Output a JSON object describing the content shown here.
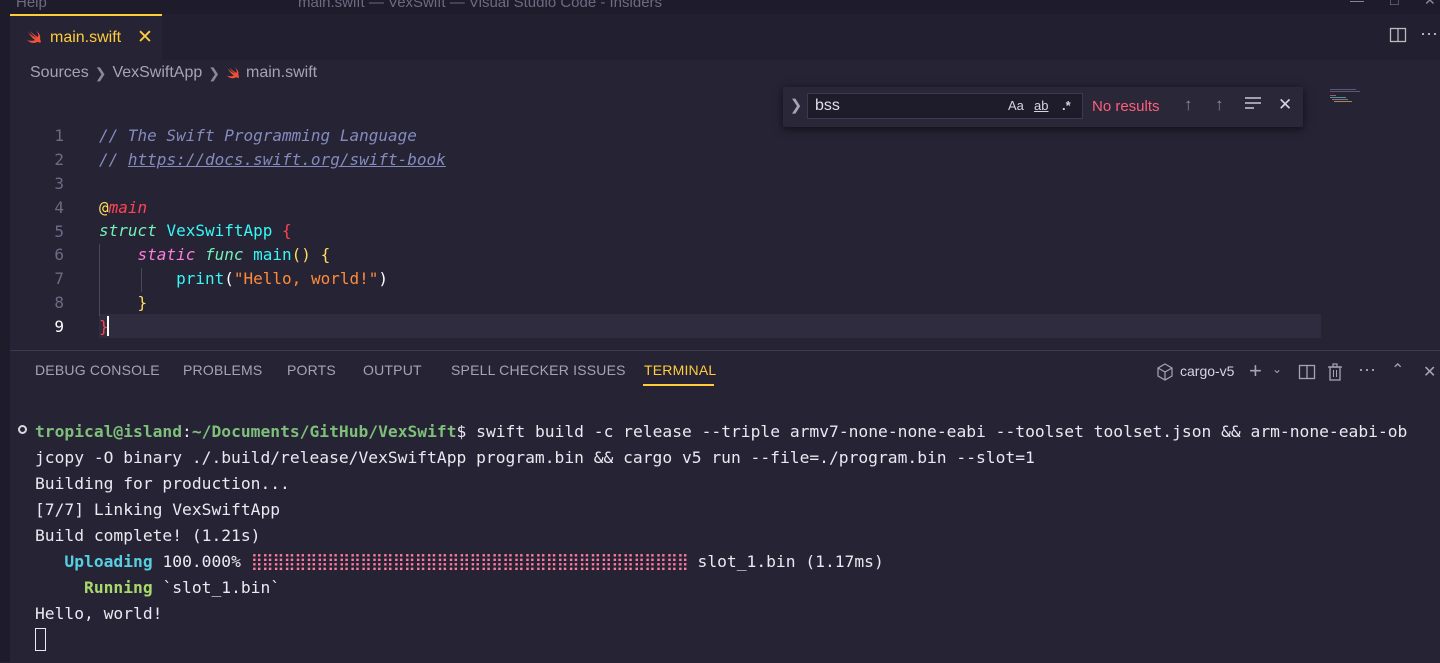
{
  "window": {
    "menu_help": "Help",
    "title": "main.swift — VexSwift — Visual Studio Code - Insiders"
  },
  "editor": {
    "tab": {
      "label": "main.swift",
      "close_icon": "close-icon"
    },
    "breadcrumb": [
      "Sources",
      "VexSwiftApp",
      "main.swift"
    ],
    "line_numbers": [
      "1",
      "2",
      "3",
      "4",
      "5",
      "6",
      "7",
      "8",
      "9"
    ],
    "current_line": "9",
    "code": {
      "l1": "// The Swift Programming Language",
      "l2_prefix": "// ",
      "l2_url": "https://docs.swift.org/swift-book",
      "l4_at": "@",
      "l4_attr": "main",
      "l5_kw": "struct",
      "l5_name": "VexSwiftApp",
      "l5_brace": "{",
      "l6_static": "static",
      "l6_func": "func",
      "l6_name": "main",
      "l6_parens": "()",
      "l6_brace": "{",
      "l7_print": "print",
      "l7_open": "(",
      "l7_str": "\"Hello, world!\"",
      "l7_close": ")",
      "l8_brace": "}",
      "l9_brace": "}"
    }
  },
  "find": {
    "query": "bss",
    "match_case": "Aa",
    "whole_word": "ab",
    "regex": ".*",
    "status": "No results"
  },
  "panel": {
    "tabs": [
      "DEBUG CONSOLE",
      "PROBLEMS",
      "PORTS",
      "OUTPUT",
      "SPELL CHECKER ISSUES",
      "TERMINAL"
    ],
    "active_tab": "TERMINAL",
    "terminal_name": "cargo-v5"
  },
  "terminal": {
    "user_host": "tropical@island",
    "colon": ":",
    "path": "~/Documents/GitHub/VexSwift",
    "prompt": "$",
    "cmd_line1": " swift build -c release --triple armv7-none-none-eabi --toolset toolset.json && arm-none-eabi-ob",
    "cmd_line2": "jcopy -O binary ./.build/release/VexSwiftApp program.bin && cargo v5 run --file=./program.bin --slot=1",
    "out1": "Building for production...",
    "out2": "[7/7] Linking VexSwiftApp",
    "out3": "Build complete! (1.21s)",
    "uploading_label": "Uploading",
    "upload_percent": "100.000%",
    "progress_fraction": 1.0,
    "upload_file": "slot_1.bin (1.17ms)",
    "running_label": "Running",
    "running_target": "`slot_1.bin`",
    "out_hello": "Hello, world!"
  },
  "colors": {
    "accent": "#ffcc3a",
    "editor_bg": "#262335",
    "status_error": "#fe5f7a"
  }
}
